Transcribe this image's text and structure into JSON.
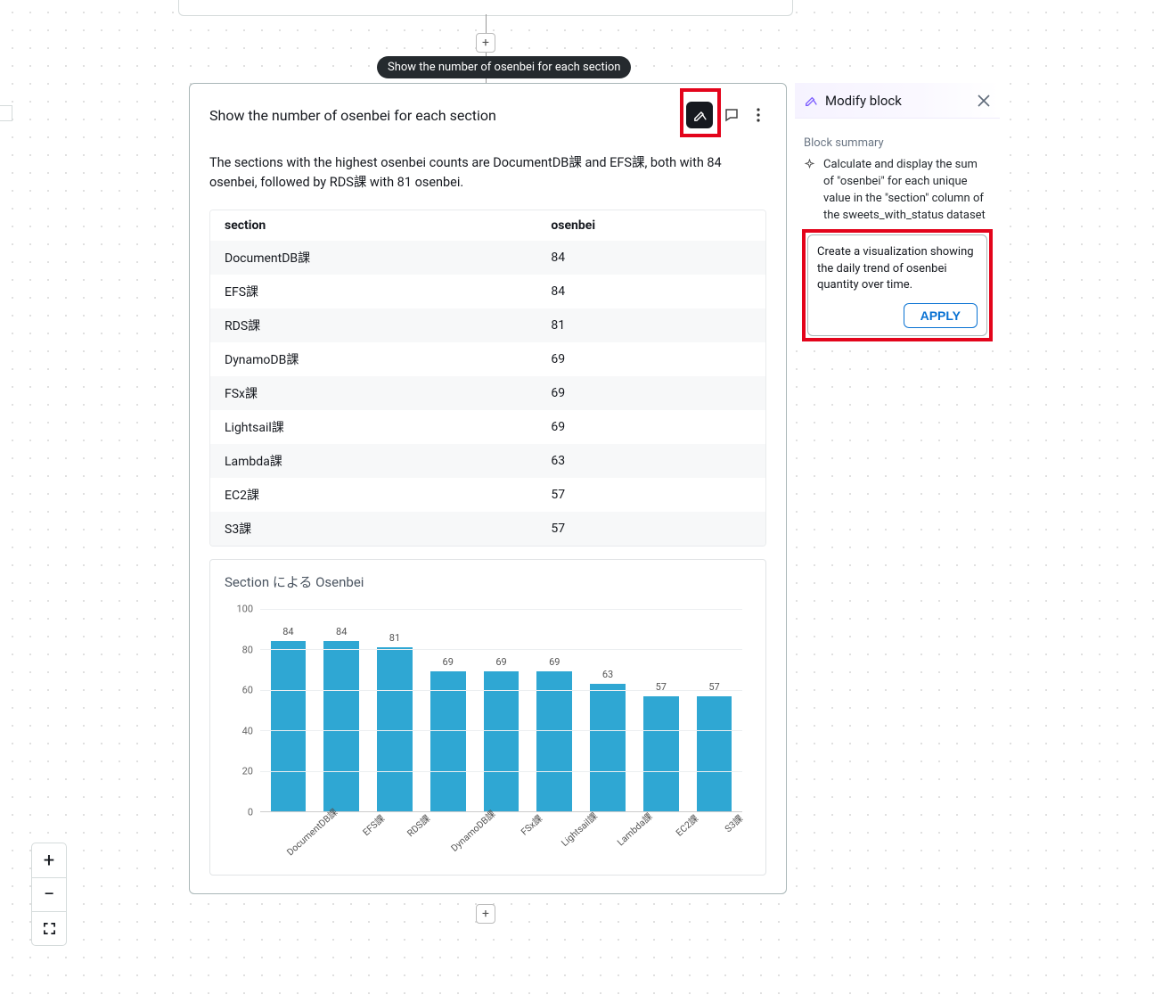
{
  "tooltip": "Show the number of osenbei for each section",
  "block": {
    "title": "Show the number of osenbei for each section",
    "summary": "The sections with the highest osenbei counts are DocumentDB課 and EFS課, both with 84 osenbei, followed by RDS課 with 81 osenbei.",
    "table": {
      "columns": {
        "section": "section",
        "osenbei": "osenbei"
      },
      "rows": [
        {
          "section": "DocumentDB課",
          "osenbei": "84"
        },
        {
          "section": "EFS課",
          "osenbei": "84"
        },
        {
          "section": "RDS課",
          "osenbei": "81"
        },
        {
          "section": "DynamoDB課",
          "osenbei": "69"
        },
        {
          "section": "FSx課",
          "osenbei": "69"
        },
        {
          "section": "Lightsail課",
          "osenbei": "69"
        },
        {
          "section": "Lambda課",
          "osenbei": "63"
        },
        {
          "section": "EC2課",
          "osenbei": "57"
        },
        {
          "section": "S3課",
          "osenbei": "57"
        }
      ]
    }
  },
  "chart_data": {
    "type": "bar",
    "title": "Section による Osenbei",
    "categories": [
      "DocumentDB課",
      "EFS課",
      "RDS課",
      "DynamoDB課",
      "FSx課",
      "Lightsail課",
      "Lambda課",
      "EC2課",
      "S3課"
    ],
    "values": [
      84,
      84,
      81,
      69,
      69,
      69,
      63,
      57,
      57
    ],
    "ylim": [
      0,
      100
    ],
    "yticks": [
      0,
      20,
      40,
      60,
      80,
      100
    ],
    "xlabel": "",
    "ylabel": ""
  },
  "side": {
    "title": "Modify block",
    "block_summary_label": "Block summary",
    "block_summary_text": "Calculate and display the sum of \"osenbei\" for each unique value in the \"section\" column of the sweets_with_status dataset",
    "modify_input": "Create a visualization showing the daily trend of osenbei quantity over time.",
    "apply_label": "APPLY"
  },
  "zoom": {
    "in": "+",
    "out": "−"
  }
}
